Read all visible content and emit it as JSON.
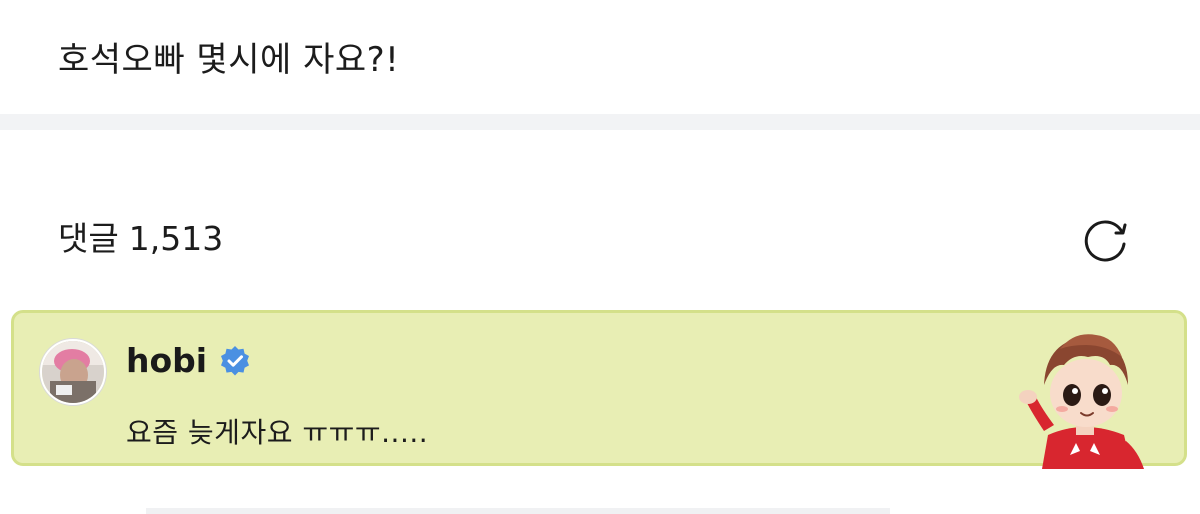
{
  "post": {
    "text": "호석오빠 몇시에 자요?!"
  },
  "comments": {
    "label": "댓글",
    "count": "1,513",
    "refresh_icon": "refresh-icon"
  },
  "highlight_comment": {
    "author": "hobi",
    "verified_icon": "verified-badge-icon",
    "text": "요즘 늦게자요 ㅠㅠㅠ.....",
    "background_color": "#e8eeb4",
    "border_color": "#d4e08a",
    "badge_color": "#4a90e2"
  }
}
